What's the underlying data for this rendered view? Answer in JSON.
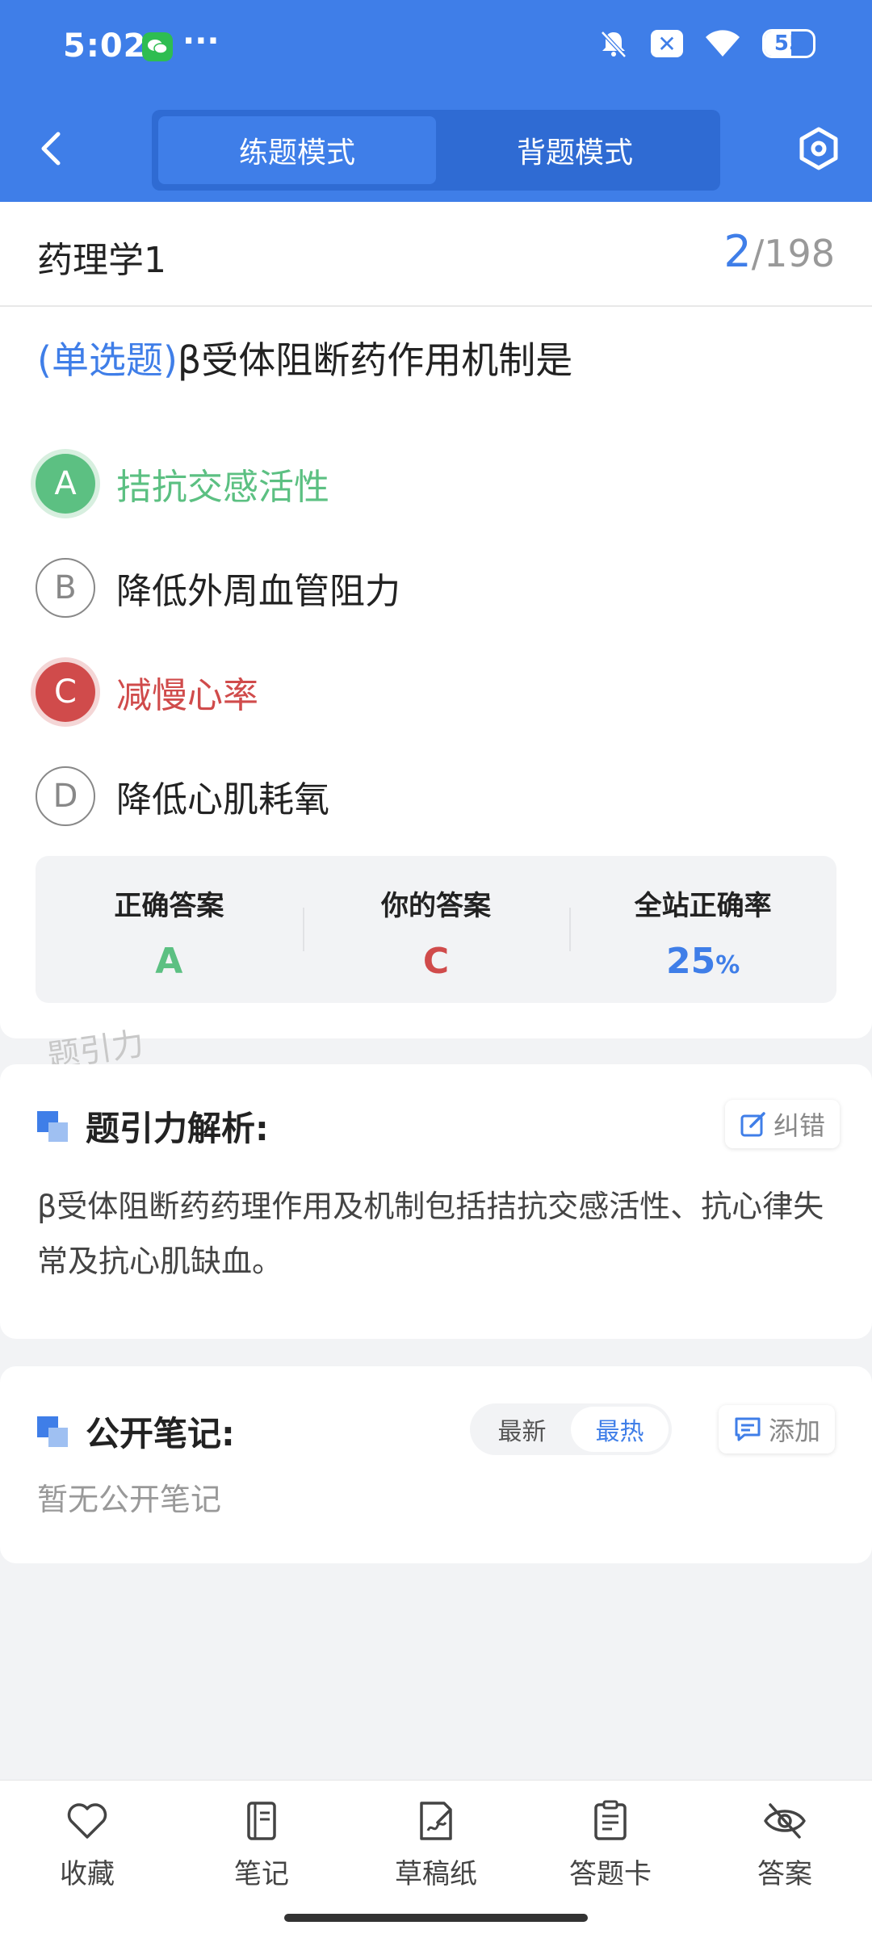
{
  "status_bar": {
    "time": "5:02",
    "dots": "···",
    "battery": "55",
    "battery_level": 0.55,
    "icons": [
      "wechat-icon",
      "bell-off-icon",
      "x-box-icon",
      "wifi-icon",
      "battery-icon"
    ]
  },
  "nav": {
    "back_icon": "chevron-left-icon",
    "tabs": [
      {
        "label": "练题模式",
        "active": true
      },
      {
        "label": "背题模式",
        "active": false
      }
    ],
    "settings_icon": "hexagon-settings-icon"
  },
  "question": {
    "subject": "药理学1",
    "current": "2",
    "total": "/198",
    "type_label": "(单选题)",
    "text": "β受体阻断药作用机制是",
    "options": [
      {
        "letter": "A",
        "text": "拮抗交感活性",
        "state": "correct"
      },
      {
        "letter": "B",
        "text": "降低外周血管阻力",
        "state": "none"
      },
      {
        "letter": "C",
        "text": "减慢心率",
        "state": "wrong"
      },
      {
        "letter": "D",
        "text": "降低心肌耗氧",
        "state": "none"
      }
    ]
  },
  "result": {
    "correct_label": "正确答案",
    "correct_value": "A",
    "yours_label": "你的答案",
    "yours_value": "C",
    "rate_label": "全站正确率",
    "rate_value": "25",
    "rate_unit": "%"
  },
  "watermark": "题引力",
  "analysis": {
    "title": "题引力解析:",
    "correct_button": "纠错",
    "text": "β受体阻断药药理作用及机制包括拮抗交感活性、抗心律失常及抗心肌缺血。"
  },
  "notes": {
    "title": "公开笔记:",
    "sort_newest": "最新",
    "sort_hottest": "最热",
    "add_button": "添加",
    "empty": "暂无公开笔记"
  },
  "bottom_bar": [
    {
      "label": "收藏",
      "icon": "heart-icon"
    },
    {
      "label": "笔记",
      "icon": "notebook-icon"
    },
    {
      "label": "草稿纸",
      "icon": "draft-paper-icon"
    },
    {
      "label": "答题卡",
      "icon": "answer-card-icon"
    },
    {
      "label": "答案",
      "icon": "eye-off-icon"
    }
  ],
  "colors": {
    "primary": "#3f7ee8",
    "correct": "#5cc082",
    "wrong": "#d04b4b"
  }
}
